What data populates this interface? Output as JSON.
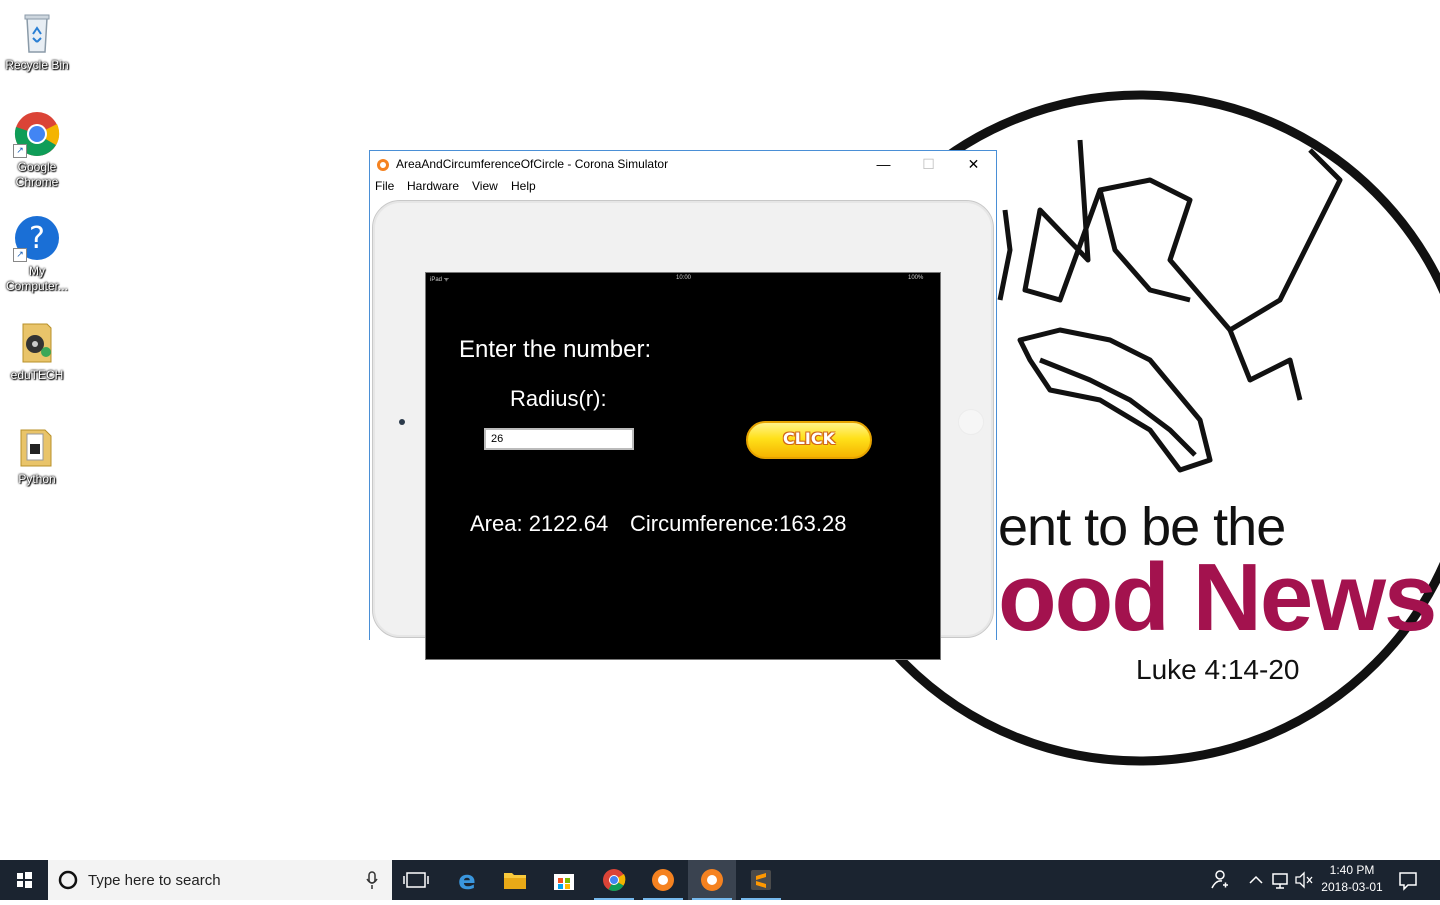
{
  "desktop": {
    "icons": [
      {
        "label": "Recycle Bin"
      },
      {
        "label": "Google Chrome"
      },
      {
        "label": "My Computer..."
      },
      {
        "label": "eduTECH"
      },
      {
        "label": "Python"
      }
    ]
  },
  "wallpaper": {
    "line1": "ent to be the",
    "line2": "ood News",
    "line3": "Luke 4:14-20",
    "accent_color": "#a3124e"
  },
  "window": {
    "title": "AreaAndCircumferenceOfCircle - Corona Simulator",
    "controls": {
      "minimize": "—",
      "maximize": "☐",
      "close": "✕"
    },
    "menu": [
      "File",
      "Hardware",
      "View",
      "Help"
    ]
  },
  "device_status": {
    "carrier": "iPad ᯤ",
    "time": "10:00",
    "battery": "100%"
  },
  "app": {
    "title": "Enter the number:",
    "radius_label": "Radius(r):",
    "radius_value": "26",
    "button_label": "CLICK",
    "area_text": "Area: 2122.64",
    "circumference_text": "Circumference:163.28"
  },
  "taskbar": {
    "search_placeholder": "Type here to search",
    "time": "1:40 PM",
    "date": "2018-03-01"
  }
}
